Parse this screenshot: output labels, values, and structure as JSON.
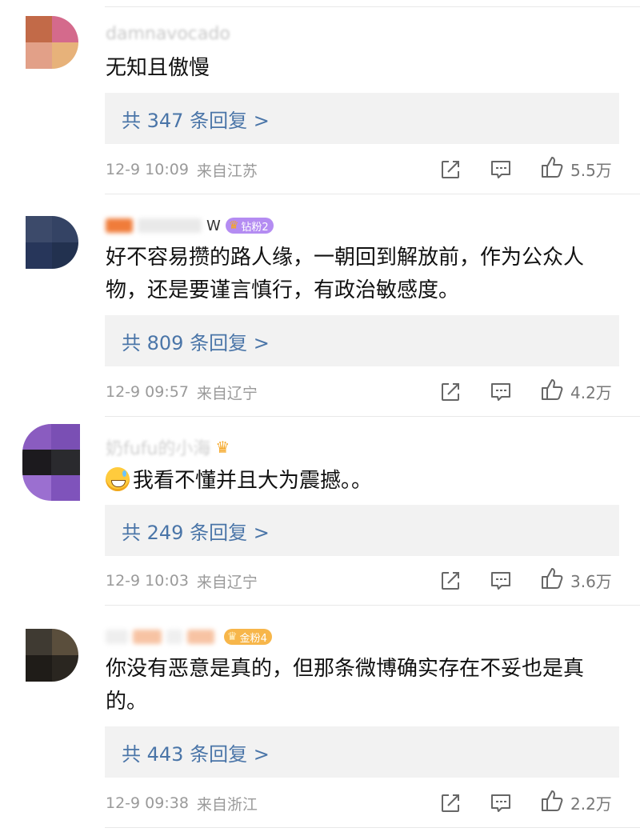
{
  "comments": [
    {
      "username": "damnavocado",
      "text": "无知且傲慢",
      "replies_label": "共 347 条回复 >",
      "time": "12-9 10:09",
      "location": "来自江苏",
      "likes": "5.5万"
    },
    {
      "username": "W",
      "badge_label": "钻粉2",
      "text": "好不容易攒的路人缘，一朝回到解放前，作为公众人物，还是要谨言慎行，有政治敏感度。",
      "replies_label": "共 809 条回复 >",
      "time": "12-9 09:57",
      "location": "来自辽宁",
      "likes": "4.2万"
    },
    {
      "username": "奶fufu的小海",
      "text": "我看不懂并且大为震撼。。",
      "replies_label": "共 249 条回复 >",
      "time": "12-9 10:03",
      "location": "来自辽宁",
      "likes": "3.6万"
    },
    {
      "username": "",
      "badge_label": "金粉4",
      "text": "你没有恶意是真的，但那条微博确实存在不妥也是真的。",
      "replies_label": "共 443 条回复 >",
      "time": "12-9 09:38",
      "location": "来自浙江",
      "likes": "2.2万"
    }
  ],
  "icons": {
    "repost": "repost-icon",
    "comment": "comment-icon",
    "like": "thumbs-up-icon",
    "emoji": "grin-sweat-emoji"
  },
  "colors": {
    "link": "#4a75a8",
    "meta": "#9a9a9a",
    "reply_bg": "#f2f2f2",
    "badge_purple": "#b48cf2",
    "badge_gold": "#f7b64a"
  }
}
